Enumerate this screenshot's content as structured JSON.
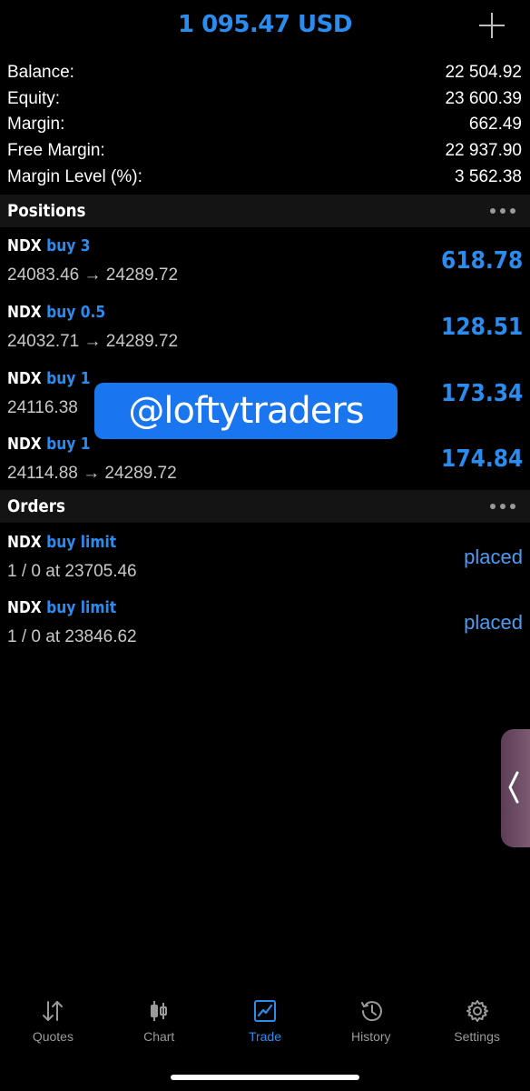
{
  "header": {
    "title": "1 095.47 USD"
  },
  "summary": [
    {
      "label": "Balance:",
      "value": "22 504.92"
    },
    {
      "label": "Equity:",
      "value": "23 600.39"
    },
    {
      "label": "Margin:",
      "value": "662.49"
    },
    {
      "label": "Free Margin:",
      "value": "22 937.90"
    },
    {
      "label": "Margin Level (%):",
      "value": "3 562.38"
    }
  ],
  "positions_header": "Positions",
  "positions": [
    {
      "symbol": "NDX",
      "type": "buy 3",
      "prices": "24083.46 → 24289.72",
      "profit": "618.78"
    },
    {
      "symbol": "NDX",
      "type": "buy 0.5",
      "prices": "24032.71 → 24289.72",
      "profit": "128.51"
    },
    {
      "symbol": "NDX",
      "type": "buy 1",
      "prices": "24116.38",
      "profit": "173.34"
    },
    {
      "symbol": "NDX",
      "type": "buy 1",
      "prices": "24114.88 → 24289.72",
      "profit": "174.84"
    }
  ],
  "watermark": "@loftytraders",
  "orders_header": "Orders",
  "orders": [
    {
      "symbol": "NDX",
      "type": "buy limit",
      "details": "1 / 0 at 23705.46",
      "status": "placed"
    },
    {
      "symbol": "NDX",
      "type": "buy limit",
      "details": "1 / 0 at 23846.62",
      "status": "placed"
    }
  ],
  "tabs": [
    {
      "label": "Quotes",
      "icon": "quotes-icon"
    },
    {
      "label": "Chart",
      "icon": "chart-icon"
    },
    {
      "label": "Trade",
      "icon": "trade-icon",
      "active": true
    },
    {
      "label": "History",
      "icon": "history-icon"
    },
    {
      "label": "Settings",
      "icon": "settings-icon"
    }
  ],
  "colors": {
    "accent": "#2b8cf0",
    "background": "#000000",
    "section": "#141414"
  }
}
